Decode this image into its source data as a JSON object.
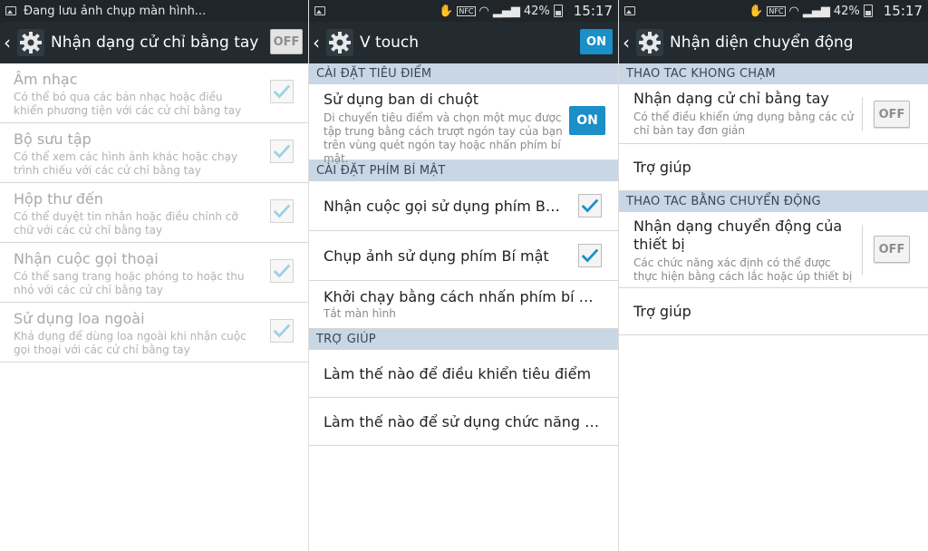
{
  "left": {
    "status_text": "Đang lưu ảnh chụp màn hình...",
    "title": "Nhận dạng cử chỉ bằng tay",
    "toggle": "OFF",
    "items": [
      {
        "title": "Âm nhạc",
        "subtitle": "Có thể bỏ qua các bản nhạc hoặc điều khiển phương tiện với các cử chỉ bằng tay"
      },
      {
        "title": "Bộ sưu tập",
        "subtitle": "Có thể xem các hình ảnh khác hoặc chạy trình chiếu với các cử chỉ bằng tay"
      },
      {
        "title": "Hộp thư đến",
        "subtitle": "Có thể duyệt tin nhắn hoặc điều chỉnh cỡ chữ với các cử chỉ bằng tay"
      },
      {
        "title": "Nhận cuộc gọi thoại",
        "subtitle": "Có thể sang trang hoặc phóng to hoặc thu nhỏ với các cử chỉ bằng tay"
      },
      {
        "title": "Sử dụng loa ngoài",
        "subtitle": "Khả dụng để dùng loa ngoài khi nhận cuộc gọi thoại với các cử chỉ bằng tay"
      }
    ]
  },
  "middle": {
    "battery": "42%",
    "time": "15:17",
    "title": "V touch",
    "toggle": "ON",
    "section_focus": "CÀI ĐẶT TIÊU ĐIỂM",
    "mouse_pad": {
      "title": "Sử dụng ban di chuột",
      "subtitle": "Di chuyển tiêu điểm và chọn một mục được tập trung bằng cách trượt ngón tay của bạn trên vùng quét ngón tay hoặc nhấn phím bí mật.",
      "toggle": "ON"
    },
    "section_secret": "CÀI ĐẶT PHÍM BÍ MẬT",
    "answer_call": "Nhận cuộc gọi sử dụng phím Bí ...",
    "take_photo": "Chụp ảnh sử dụng phím Bí mật",
    "launch": {
      "title": "Khởi chạy bằng cách nhấn phím bí mậ...",
      "subtitle": "Tắt màn hình"
    },
    "section_help": "TRỢ GIÚP",
    "help_focus": "Làm thế nào để điều khiển tiêu điểm",
    "help_function": "Làm thế nào để sử dụng chức năng ph..."
  },
  "right": {
    "battery": "42%",
    "time": "15:17",
    "title": "Nhận diện chuyển động",
    "section_touchless": "THAO TAC KHONG CHẠM",
    "hand_gesture": {
      "title": "Nhận dạng cử chỉ bằng tay",
      "subtitle": "Có thể điều khiển ứng dụng bằng các cử chỉ bàn tay đơn giản",
      "toggle": "OFF"
    },
    "help1": "Trợ giúp",
    "section_motion": "THAO TAC BẰNG CHUYỂN ĐỘNG",
    "motion": {
      "title": "Nhận dạng chuyển động của thiết bị",
      "subtitle": "Các chức năng xác định có thể được thực hiện bằng cách lắc hoặc úp thiết bị",
      "toggle": "OFF"
    },
    "help2": "Trợ giúp"
  }
}
